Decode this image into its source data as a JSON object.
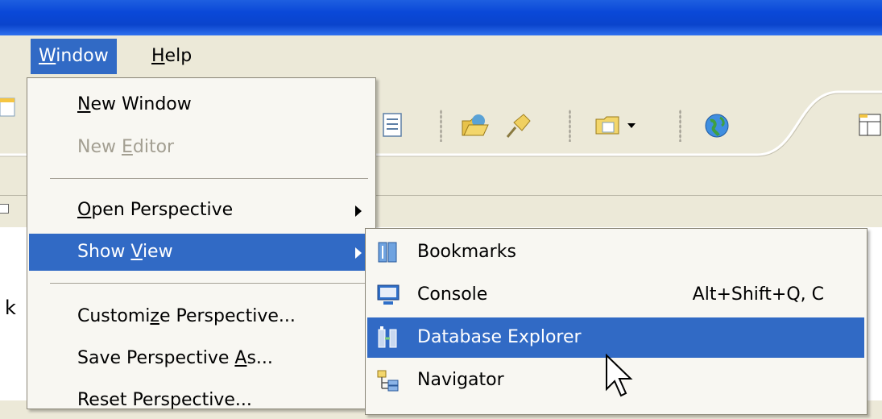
{
  "menubar": {
    "items": [
      {
        "label_acc": "W",
        "label_rest": "indow"
      },
      {
        "label_acc": "H",
        "label_rest": "elp"
      }
    ]
  },
  "toolbar": {
    "icons": [
      "task-list-icon",
      "open-folder-icon",
      "pin-icon",
      "new-folder-icon",
      "globe-icon",
      "perspective-icon"
    ]
  },
  "window_menu": {
    "new_window": {
      "acc": "N",
      "rest": "ew Window"
    },
    "new_editor": {
      "before": "New ",
      "acc": "E",
      "rest": "ditor"
    },
    "open_perspective": {
      "acc": "O",
      "rest": "pen Perspective"
    },
    "show_view": {
      "before": "Show ",
      "acc": "V",
      "rest": "iew"
    },
    "customize_perspective": {
      "before": "Customi",
      "acc": "z",
      "rest": "e Perspective..."
    },
    "save_perspective": {
      "before": "Save Perspective ",
      "acc": "A",
      "rest": "s..."
    },
    "reset_perspective": "Reset Perspective..."
  },
  "show_view_menu": {
    "items": [
      {
        "label": "Bookmarks",
        "shortcut": "",
        "icon": "bookmarks-icon"
      },
      {
        "label": "Console",
        "shortcut": "Alt+Shift+Q, C",
        "icon": "console-icon"
      },
      {
        "label": "Database Explorer",
        "shortcut": "",
        "icon": "database-explorer-icon"
      },
      {
        "label": "Navigator",
        "shortcut": "",
        "icon": "navigator-icon"
      }
    ]
  },
  "background": {
    "partial_text": "k"
  },
  "colors": {
    "titlebar": "#0a48d8",
    "highlight": "#316ac5",
    "menu_bg": "#f8f7f2",
    "chrome": "#ece9d8"
  }
}
